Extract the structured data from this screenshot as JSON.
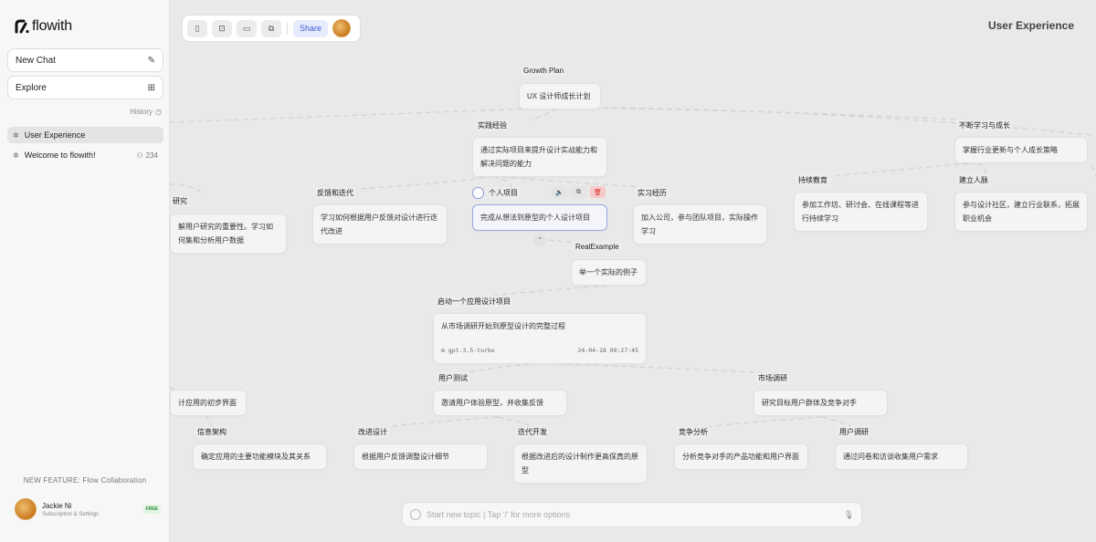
{
  "app": {
    "logo_text": "flowith",
    "page_title": "User Experience"
  },
  "sidebar": {
    "new_chat_label": "New Chat",
    "explore_label": "Explore",
    "history_label": "History",
    "items": [
      {
        "label": "User Experience",
        "active": true
      },
      {
        "label": "Welcome to flowith!",
        "count": "234"
      }
    ],
    "new_feature": "NEW FEATURE: Flow Collaboration",
    "user": {
      "name": "Jackie Ni",
      "sub": "Subscription & Settings",
      "badge": "FREE"
    }
  },
  "toolbar": {
    "share_label": "Share"
  },
  "input": {
    "placeholder": "Start new topic | Tap '/' for more options"
  },
  "nodes": {
    "growth": {
      "label": "Growth Plan",
      "text": "UX 设计师成长计划"
    },
    "practice": {
      "label": "实践经验",
      "text": "通过实际项目来提升设计实战能力和解决问题的能力"
    },
    "learn": {
      "label": "不断学习与成长",
      "text": "掌握行业更新与个人成长策略"
    },
    "research": {
      "label": "研究",
      "text": "解用户研究的重要性。学习如何集和分析用户数据"
    },
    "feedback": {
      "label": "反馈和迭代",
      "text": "学习如何根据用户反馈对设计进行迭代改进"
    },
    "personal": {
      "label": "个人项目",
      "text": "完成从想法到原型的个人设计项目"
    },
    "intern": {
      "label": "实习经历",
      "text": "加入公司，参与团队项目，实际操作学习"
    },
    "continue": {
      "label": "持续教育",
      "text": "参加工作坊、研讨会、在线课程等进行持续学习"
    },
    "network": {
      "label": "建立人脉",
      "text": "参与设计社区，建立行业联系，拓展职业机会"
    },
    "example": {
      "label": "RealExample",
      "text": "举一个实际的例子"
    },
    "startapp": {
      "label": "启动一个应用设计项目",
      "text": "从市场调研开始到原型设计的完整过程",
      "model": "gpt-3.5-turbo",
      "time": "24-04-18 09:27:45"
    },
    "initial": {
      "text": "计应用的初步界面"
    },
    "usertest": {
      "label": "用户测试",
      "text": "邀请用户体验原型，并收集反馈"
    },
    "market": {
      "label": "市场调研",
      "text": "研究目标用户群体及竞争对手"
    },
    "infoarch": {
      "label": "信息架构",
      "text": "确定应用的主要功能模块及其关系"
    },
    "improve": {
      "label": "改进设计",
      "text": "根据用户反馈调整设计细节"
    },
    "iterdev": {
      "label": "迭代开发",
      "text": "根据改进后的设计制作更高保真的原型"
    },
    "compete": {
      "label": "竞争分析",
      "text": "分析竞争对手的产品功能和用户界面"
    },
    "userresearch": {
      "label": "用户调研",
      "text": "通过问卷和访谈收集用户需求"
    }
  }
}
